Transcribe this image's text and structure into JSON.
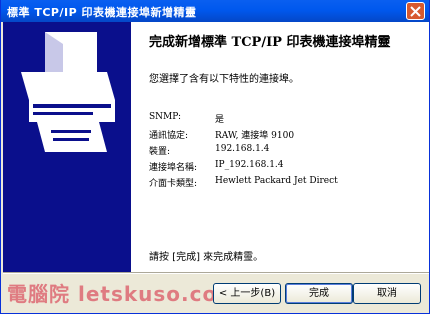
{
  "window": {
    "title": "標準 TCP/IP 印表機連接埠新增精靈"
  },
  "main": {
    "heading": "完成新增標準 TCP/IP 印表機連接埠精靈",
    "intro": "您選擇了含有以下特性的連接埠。",
    "fields": [
      {
        "label": "SNMP:",
        "value": "是"
      },
      {
        "label": "通訊協定:",
        "value": "RAW, 連接埠 9100"
      },
      {
        "label": "裝置:",
        "value": "192.168.1.4"
      },
      {
        "label": "連接埠名稱:",
        "value": "IP_192.168.1.4"
      },
      {
        "label": "介面卡類型:",
        "value": "Hewlett Packard Jet Direct"
      }
    ],
    "finish_note": "請按 [完成] 來完成精靈。"
  },
  "buttons": {
    "back": "< 上一步(B)",
    "finish": "完成",
    "cancel": "取消"
  },
  "watermark": "電腦院 letskuso.com",
  "colors": {
    "titlebar": "#0058ee",
    "banner": "#0a0f8c",
    "dialog": "#ece9d8"
  }
}
